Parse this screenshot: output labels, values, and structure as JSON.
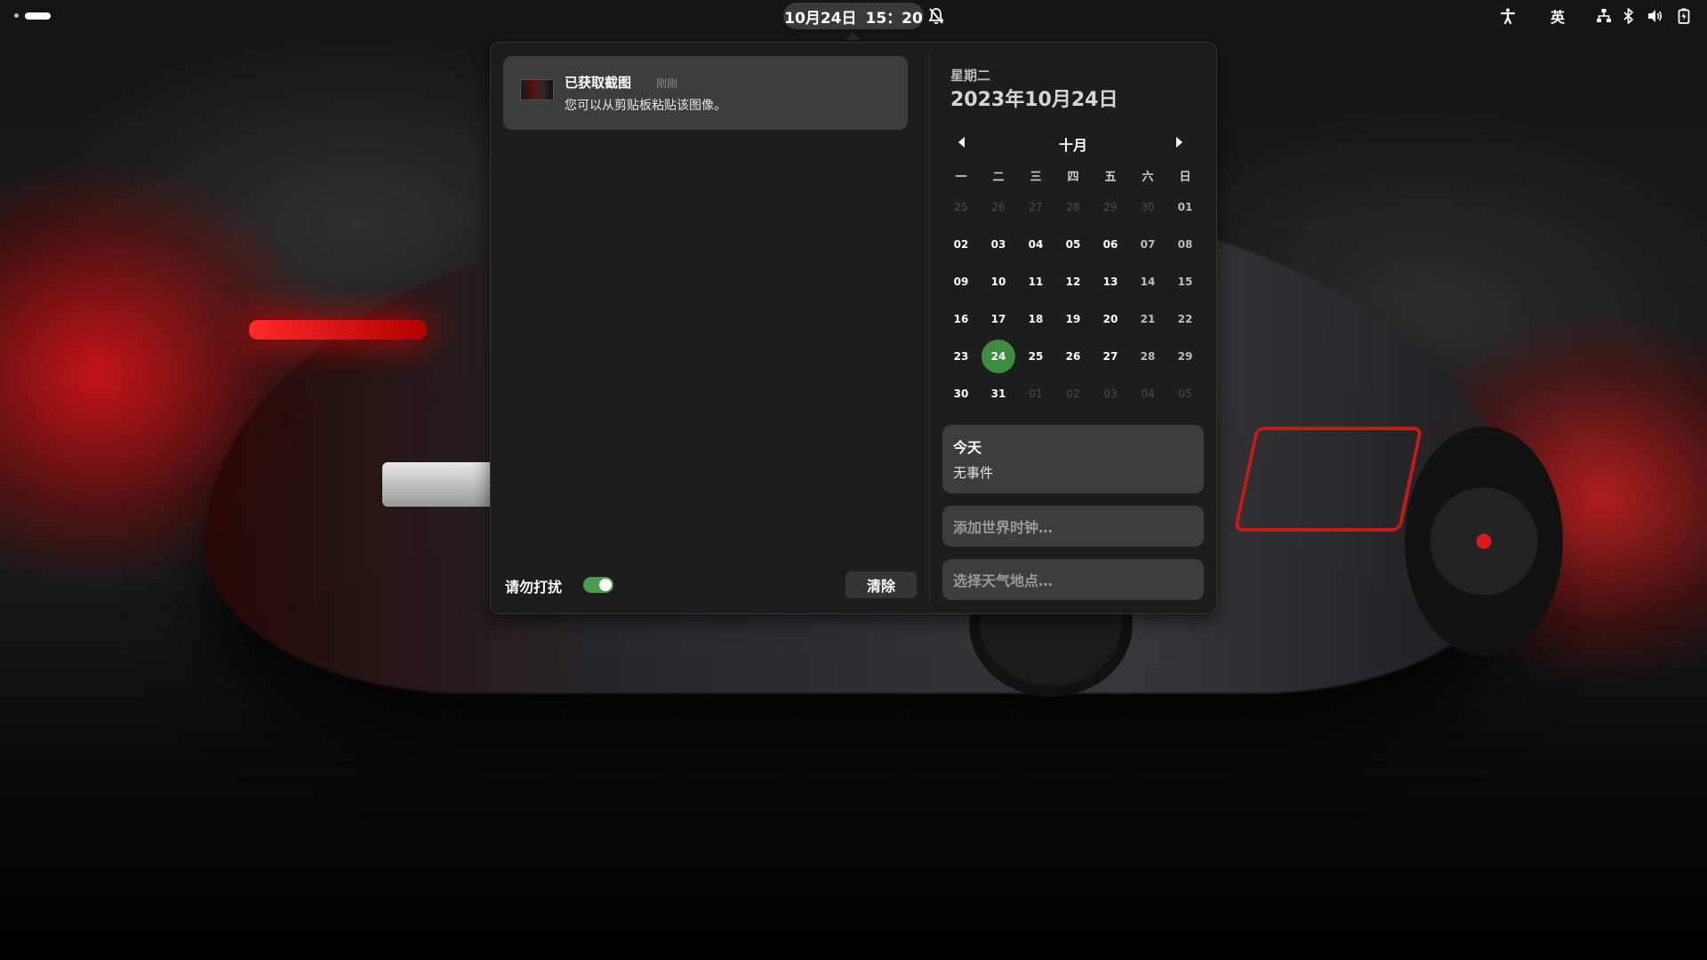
{
  "topbar": {
    "clock_date": "10月24日",
    "clock_time": "15：20",
    "input_method": "英",
    "icons": [
      "accessibility-icon",
      "network-wired-icon",
      "bluetooth-icon",
      "volume-icon",
      "battery-icon",
      "notifications-disabled-icon"
    ]
  },
  "notification": {
    "title": "已获取截图",
    "time": "刚刚",
    "body": "您可以从剪贴板粘贴该图像。"
  },
  "dnd": {
    "label": "请勿打扰",
    "enabled": true
  },
  "clear_label": "清除",
  "calendar": {
    "weekday": "星期二",
    "full_date": "2023年10月24日",
    "month": "十月",
    "day_headers": [
      "一",
      "二",
      "三",
      "四",
      "五",
      "六",
      "日"
    ],
    "weeks": [
      [
        "25",
        "26",
        "27",
        "28",
        "29",
        "30",
        "01"
      ],
      [
        "02",
        "03",
        "04",
        "05",
        "06",
        "07",
        "08"
      ],
      [
        "09",
        "10",
        "11",
        "12",
        "13",
        "14",
        "15"
      ],
      [
        "16",
        "17",
        "18",
        "19",
        "20",
        "21",
        "22"
      ],
      [
        "23",
        "24",
        "25",
        "26",
        "27",
        "28",
        "29"
      ],
      [
        "30",
        "31",
        "01",
        "02",
        "03",
        "04",
        "05"
      ]
    ],
    "selected_day": "24",
    "accent_color": "#3e8c41"
  },
  "events": {
    "title": "今天",
    "body": "无事件"
  },
  "world_clock_label": "添加世界时钟…",
  "weather_label": "选择天气地点…"
}
